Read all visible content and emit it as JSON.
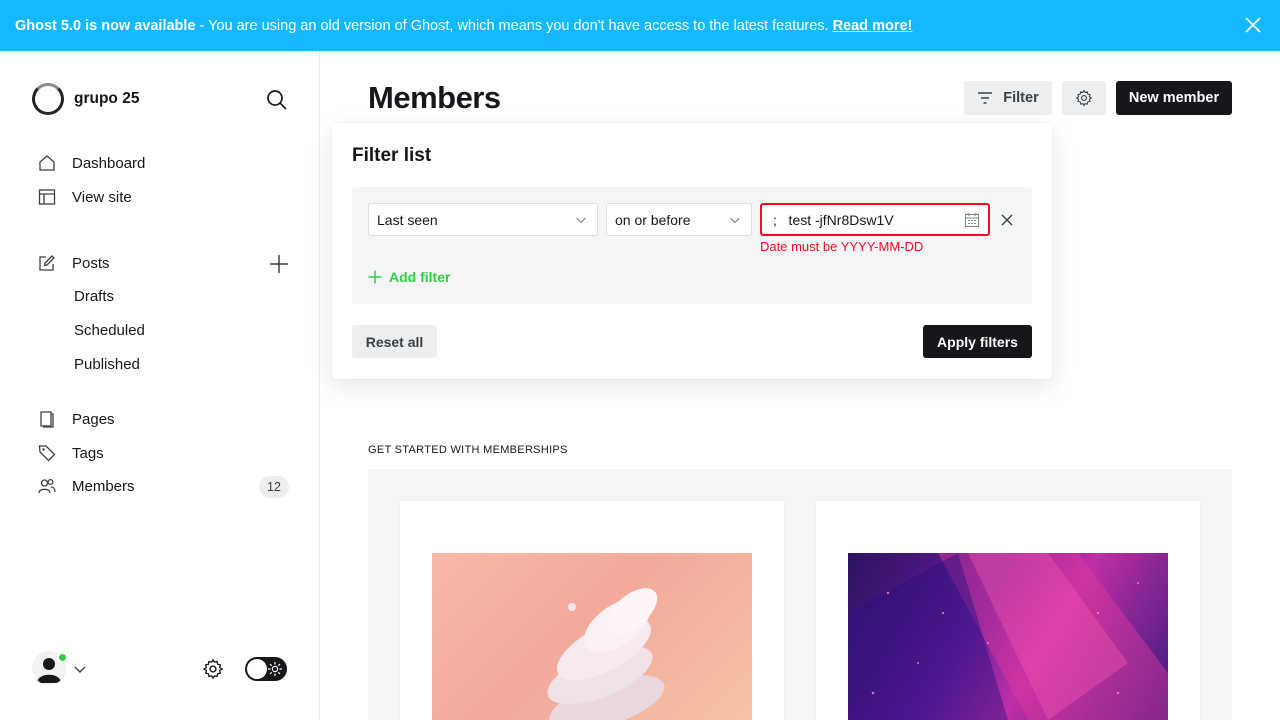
{
  "banner": {
    "title": "Ghost 5.0 is now available",
    "message": "- You are using an old version of Ghost, which means you don't have access to the latest features.",
    "link": "Read more!"
  },
  "sidebar": {
    "site_name": "grupo 25",
    "nav": {
      "dashboard": "Dashboard",
      "view_site": "View site",
      "posts": "Posts",
      "drafts": "Drafts",
      "scheduled": "Scheduled",
      "published": "Published",
      "pages": "Pages",
      "tags": "Tags",
      "members": "Members",
      "members_count": "12"
    }
  },
  "header": {
    "title": "Members",
    "filter_label": "Filter",
    "new_member_label": "New member"
  },
  "filter_popover": {
    "title": "Filter list",
    "field_value": "Last seen",
    "operator_value": "on or before",
    "date_value": ";   test -jfNr8Dsw1V",
    "error": "Date must be YYYY-MM-DD",
    "add_filter": "Add filter",
    "reset_all": "Reset all",
    "apply_filters": "Apply filters"
  },
  "memberships": {
    "section_label": "GET STARTED WITH MEMBERSHIPS"
  },
  "colors": {
    "banner": "#14b8ff",
    "accent_green": "#30cf43",
    "error_red": "#f50b23",
    "dark": "#15171a"
  }
}
